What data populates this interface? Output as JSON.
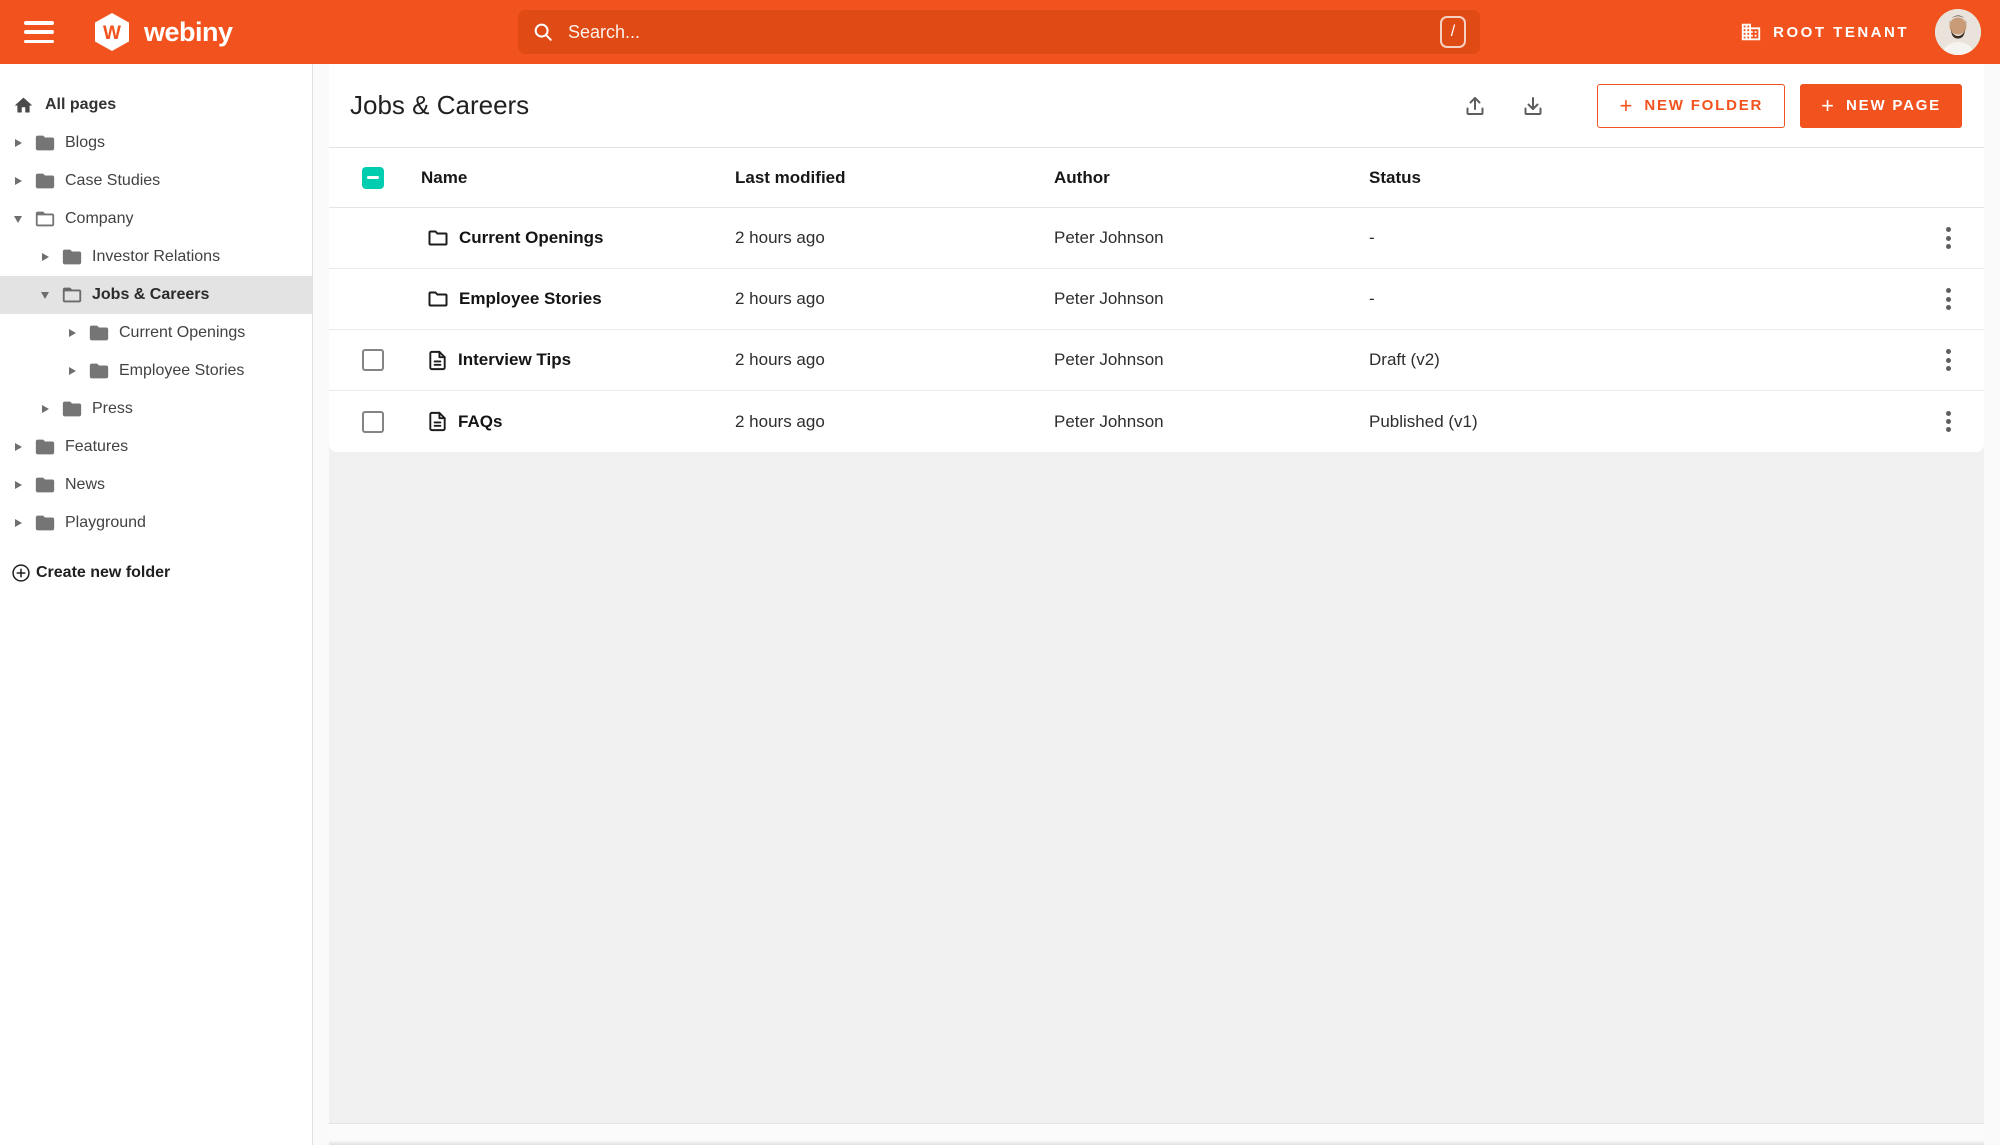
{
  "colors": {
    "accent": "#f2521d",
    "search_field": "#e04b15",
    "checkbox_teal": "#00ccb0",
    "sidebar_selected": "#e3e3e3"
  },
  "topbar": {
    "brand": "webiny",
    "search_placeholder": "Search...",
    "shortcut_key": "/",
    "tenant_label": "ROOT TENANT"
  },
  "sidebar": {
    "all_pages_label": "All pages",
    "create_folder_label": "Create new folder",
    "items": [
      {
        "label": "Blogs",
        "level": 0,
        "state": "collapsed"
      },
      {
        "label": "Case Studies",
        "level": 0,
        "state": "collapsed"
      },
      {
        "label": "Company",
        "level": 0,
        "state": "expanded"
      },
      {
        "label": "Investor Relations",
        "level": 1,
        "state": "collapsed"
      },
      {
        "label": "Jobs & Careers",
        "level": 1,
        "state": "expanded",
        "selected": true
      },
      {
        "label": "Current Openings",
        "level": 2,
        "state": "collapsed"
      },
      {
        "label": "Employee Stories",
        "level": 2,
        "state": "collapsed"
      },
      {
        "label": "Press",
        "level": 1,
        "state": "collapsed"
      },
      {
        "label": "Features",
        "level": 0,
        "state": "collapsed"
      },
      {
        "label": "News",
        "level": 0,
        "state": "collapsed"
      },
      {
        "label": "Playground",
        "level": 0,
        "state": "collapsed"
      }
    ]
  },
  "main": {
    "title": "Jobs & Careers",
    "plus_sign": "+",
    "new_folder_label": "NEW FOLDER",
    "new_page_label": "NEW PAGE",
    "table": {
      "columns": [
        "Name",
        "Last modified",
        "Author",
        "Status"
      ],
      "rows": [
        {
          "type": "folder",
          "name": "Current Openings",
          "modified": "2 hours ago",
          "author": "Peter Johnson",
          "status": "-"
        },
        {
          "type": "folder",
          "name": "Employee Stories",
          "modified": "2 hours ago",
          "author": "Peter Johnson",
          "status": "-"
        },
        {
          "type": "page",
          "name": "Interview Tips",
          "modified": "2 hours ago",
          "author": "Peter Johnson",
          "status": "Draft (v2)"
        },
        {
          "type": "page",
          "name": "FAQs",
          "modified": "2 hours ago",
          "author": "Peter Johnson",
          "status": "Published (v1)"
        }
      ]
    }
  }
}
